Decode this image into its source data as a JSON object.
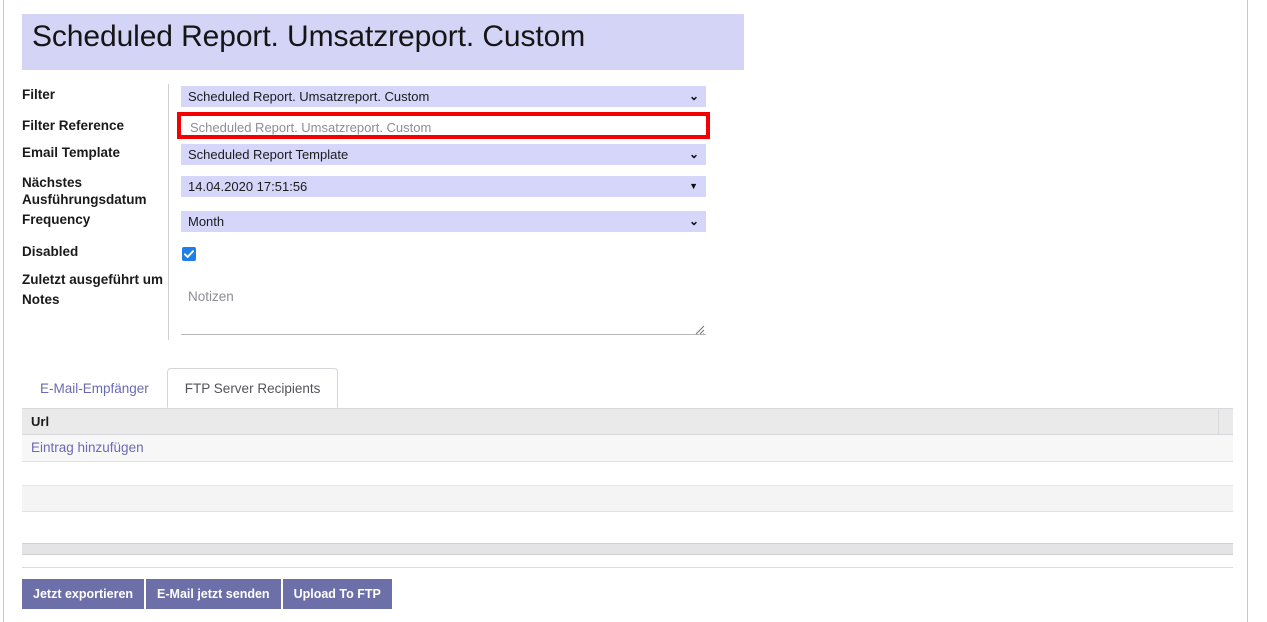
{
  "page": {
    "title": "Scheduled Report. Umsatzreport. Custom"
  },
  "form": {
    "fields": [
      {
        "label": "Filter",
        "type": "select",
        "value": "Scheduled Report. Umsatzreport. Custom",
        "icon": "chevron-down-icon"
      },
      {
        "label": "Filter Reference",
        "type": "text",
        "value": "",
        "placeholder": "Scheduled Report. Umsatzreport. Custom",
        "highlight_color": "#f40000"
      },
      {
        "label": "Email Template",
        "type": "select",
        "value": "Scheduled Report Template",
        "icon": "chevron-down-icon"
      },
      {
        "label": "Nächstes Ausführungsdatum",
        "type": "datetime",
        "value": "14.04.2020 17:51:56",
        "icon": "triangle-down-icon"
      },
      {
        "label": "Frequency",
        "type": "select",
        "value": "Month",
        "icon": "chevron-down-icon"
      },
      {
        "label": "Disabled",
        "type": "checkbox",
        "checked": true,
        "color": "#1e7fe8"
      },
      {
        "label": "Zuletzt ausgeführt um",
        "type": "readonly",
        "value": ""
      },
      {
        "label": "Notes",
        "type": "textarea",
        "value": "",
        "placeholder": "Notizen"
      }
    ],
    "label_filter": "Filter",
    "label_filter_reference": "Filter Reference",
    "label_email_template": "Email Template",
    "label_next_exec_line1": "Nächstes",
    "label_next_exec_line2": "Ausführungsdatum",
    "label_frequency": "Frequency",
    "label_disabled": "Disabled",
    "label_last_run": "Zuletzt ausgeführt um",
    "label_notes": "Notes",
    "value_filter": "Scheduled Report. Umsatzreport. Custom",
    "placeholder_filter_reference": "Scheduled Report. Umsatzreport. Custom",
    "value_email_template": "Scheduled Report Template",
    "value_next_exec": "14.04.2020 17:51:56",
    "value_frequency": "Month",
    "placeholder_notes": "Notizen",
    "chevron": "⌄",
    "triangle": "▼"
  },
  "tabs": {
    "items": [
      {
        "label": "E-Mail-Empfänger",
        "active": false
      },
      {
        "label": "FTP Server Recipients",
        "active": true
      }
    ],
    "tab_email_recipients": "E-Mail-Empfänger",
    "tab_ftp_recipients": "FTP Server Recipients"
  },
  "table": {
    "columns": [
      "Url"
    ],
    "column_url": "Url",
    "rows": [],
    "add_row_label": "Eintrag hinzufügen"
  },
  "buttons": {
    "items": [
      {
        "label": "Jetzt exportieren"
      },
      {
        "label": "E-Mail jetzt senden"
      },
      {
        "label": "Upload To FTP"
      }
    ],
    "export_now": "Jetzt exportieren",
    "send_email_now": "E-Mail jetzt senden",
    "upload_to_ftp": "Upload To FTP"
  },
  "colors": {
    "banner": "#d4d4f7",
    "field": "#d6d6fb",
    "accent_purple": "#6d6fa8",
    "link": "#6a6ab4",
    "annotation_red": "#f40000",
    "checkbox_blue": "#1e7fe8"
  }
}
